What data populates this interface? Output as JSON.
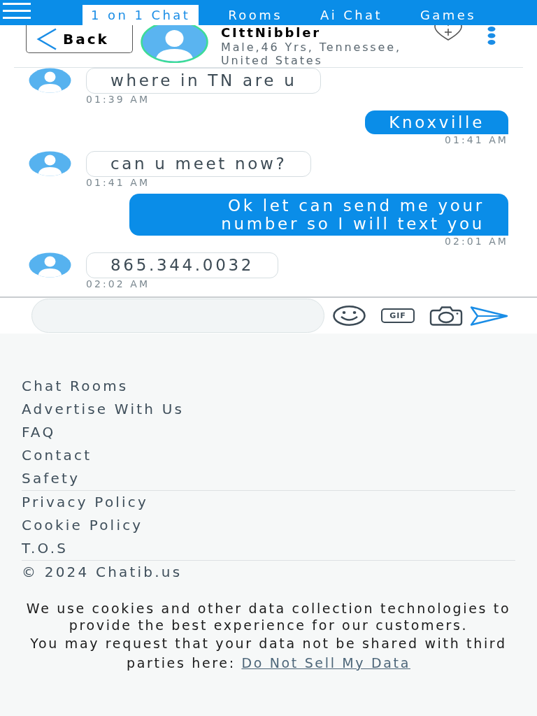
{
  "nav": {
    "tabs": [
      {
        "label": "1 on 1 Chat",
        "selected": true
      },
      {
        "label": "Rooms",
        "selected": false
      },
      {
        "label": "Ai Chat",
        "selected": false
      },
      {
        "label": "Games",
        "selected": false
      }
    ]
  },
  "profile": {
    "back_label": "Back",
    "name": "CIttNibbler",
    "details": "Male,46 Yrs, Tennessee, United States"
  },
  "messages": [
    {
      "kind": "received",
      "text": "where in TN are u",
      "time": "01:39 AM"
    },
    {
      "kind": "sent",
      "text": "Knoxville",
      "time": "01:41 AM"
    },
    {
      "kind": "received",
      "text": "can u meet now?",
      "time": "01:41 AM"
    },
    {
      "kind": "sent",
      "text": "Ok let can send me your number so I will text you",
      "time": "02:01 AM"
    },
    {
      "kind": "received",
      "text": "865.344.0032",
      "time": "02:02 AM"
    }
  ],
  "composer": {
    "gif_label": "GIF"
  },
  "footer": {
    "link_groups": [
      {
        "links": [
          "Chat Rooms",
          "Advertise With Us",
          "FAQ",
          "Contact",
          "Safety"
        ]
      },
      {
        "links": [
          "Privacy Policy",
          "Cookie Policy",
          "T.O.S"
        ]
      }
    ],
    "copyright": "© 2024 Chatib.us"
  },
  "cookie_notice": {
    "text": "We use cookies and other data collection technologies to provide the best experience for our customers.",
    "request_text": "You may request that your data not be shared with third parties here:",
    "link": "Do Not Sell My Data"
  }
}
